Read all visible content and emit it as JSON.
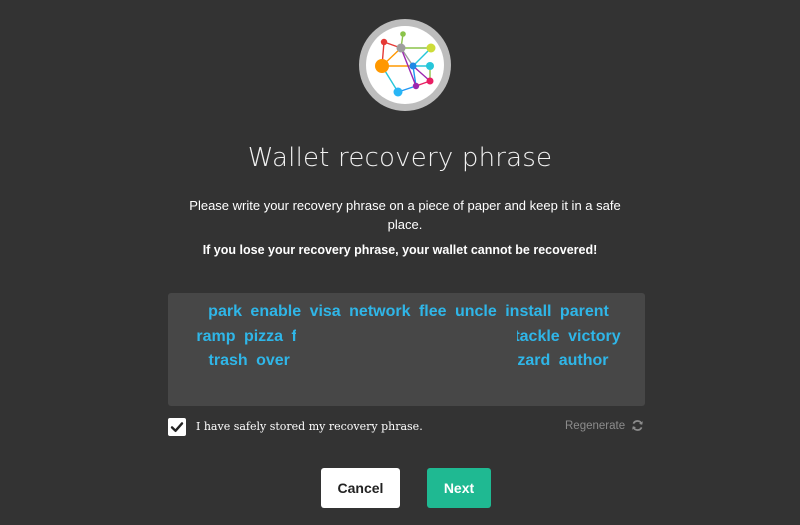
{
  "logo": {
    "icon": "wallet-network-logo-icon"
  },
  "title": "Wallet recovery phrase",
  "description": "Please write your recovery phrase on a piece of paper and keep it in a safe place.",
  "warning": "If you lose your recovery phrase, your wallet cannot be recovered!",
  "phrase": {
    "words": [
      "park",
      "enable",
      "visa",
      "network",
      "flee",
      "uncle",
      "install",
      "parent",
      "ramp",
      "pizza",
      "f",
      "tackle",
      "victory",
      "trash",
      "over",
      "zard",
      "author"
    ],
    "color": "#2fb6e8"
  },
  "confirm": {
    "label": "I have safely stored my recovery phrase.",
    "checked": true
  },
  "regenerate": {
    "label": "Regenerate",
    "icon": "refresh-icon"
  },
  "buttons": {
    "cancel": "Cancel",
    "next": "Next"
  },
  "colors": {
    "background": "#333333",
    "accent": "#1fb992",
    "phrase_box": "#474747"
  }
}
